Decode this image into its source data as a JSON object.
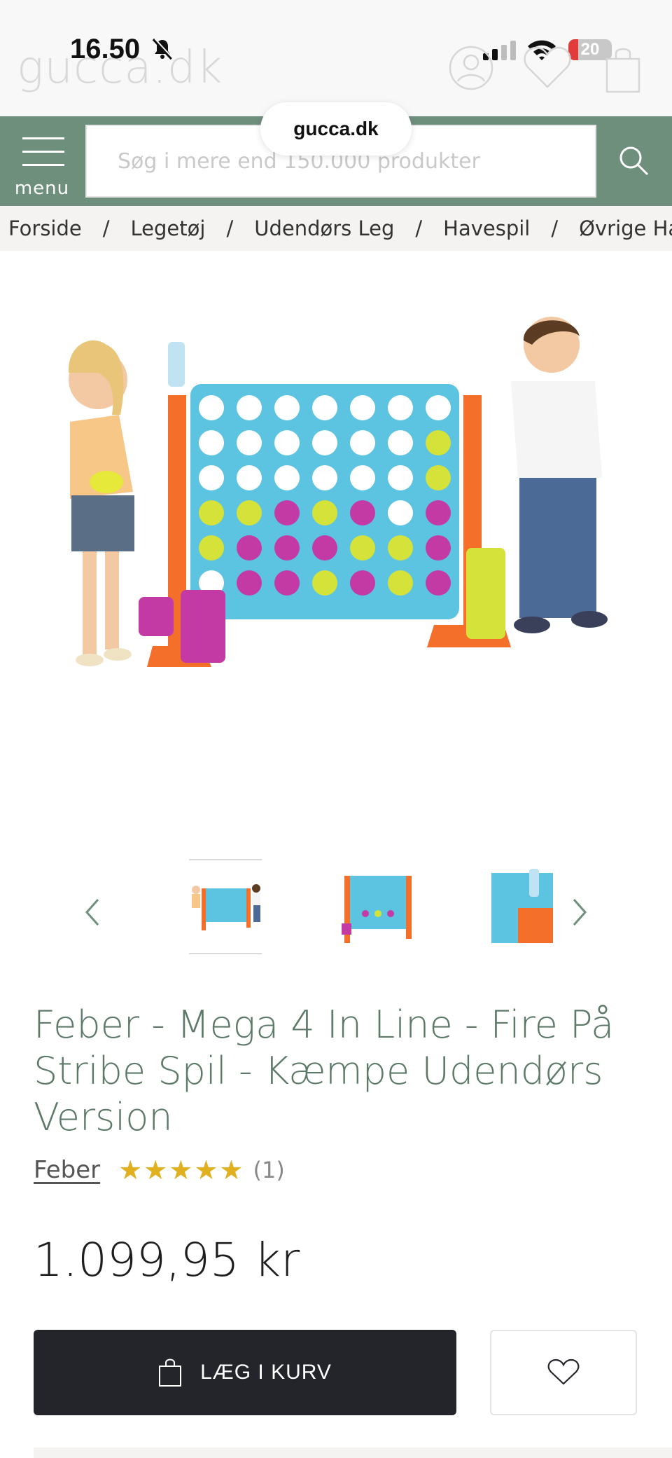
{
  "status_bar": {
    "time": "16.50",
    "battery_level": "20",
    "battery_color": "#e23b3b"
  },
  "browser": {
    "url": "gucca.dk"
  },
  "header": {
    "logo_text": "gucca.dk",
    "icons": [
      "user-icon",
      "heart-icon",
      "shopping-bag-icon"
    ]
  },
  "searchbar": {
    "menu_label": "menu",
    "placeholder": "Søg i mere end 150.000 produkter",
    "bg_color": "#6f8f7d"
  },
  "breadcrumb": [
    "Forside",
    "Legetøj",
    "Udendørs Leg",
    "Havespil",
    "Øvrige Havespil"
  ],
  "breadcrumb_separator": "/",
  "gallery": {
    "thumbnail_count": 3,
    "active_index": 0
  },
  "product": {
    "title": "Feber - Mega 4 In Line - Fire På Stribe Spil - Kæmpe Udendørs Version",
    "brand": "Feber",
    "rating_stars": 5,
    "review_count": "(1)",
    "price": "1.099,95 kr",
    "add_to_cart_label": "LÆG I KURV",
    "title_color": "#5d7a69",
    "star_color": "#e0b020"
  }
}
